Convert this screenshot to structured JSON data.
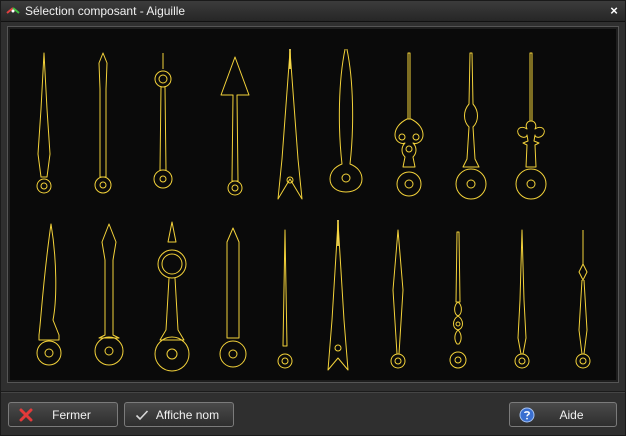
{
  "window": {
    "title": "Sélection composant - Aiguille",
    "close_glyph": "×"
  },
  "gallery": {
    "accent_color": "#f3d23a",
    "background_color": "#0a0a0a",
    "items_visible": 19
  },
  "footer": {
    "close_label": "Fermer",
    "show_names_label": "Affiche nom",
    "help_label": "Aide"
  },
  "icons": {
    "title": "clock-hands-app-icon",
    "close": "close-icon",
    "fermer": "red-cross-icon",
    "affiche_nom": "checkmark-icon",
    "aide": "help-question-icon"
  }
}
